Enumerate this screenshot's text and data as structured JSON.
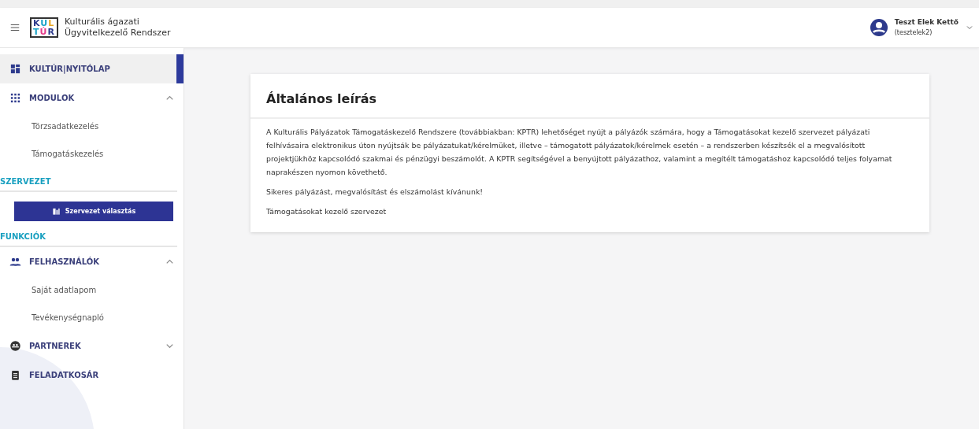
{
  "header": {
    "logo_top": "KUL",
    "logo_bottom": "TÚR",
    "app_title_line1": "Kulturális ágazati",
    "app_title_line2": "Ügyvitelkezelő Rendszer",
    "user_name": "Teszt Elek Kettő",
    "user_login": "(tesztelek2)"
  },
  "sidebar": [
    {
      "kind": "item",
      "label": "KULTÚR|NYITÓLAP",
      "selected": true
    },
    {
      "kind": "group",
      "label": "MODULOK",
      "expanded": true,
      "children": [
        {
          "label": "Törzsadatkezelés",
          "selected": false
        },
        {
          "label": "Támogatáskezelés",
          "selected": false
        }
      ]
    },
    {
      "kind": "heading",
      "label": "SZERVEZET"
    },
    {
      "kind": "button",
      "label": "Szervezet választás"
    },
    {
      "kind": "heading",
      "label": "FUNKCIÓK"
    },
    {
      "kind": "group",
      "label": "FELHASZNÁLÓK",
      "expanded": true,
      "children": [
        {
          "label": "Saját adatlapom",
          "selected": false
        },
        {
          "label": "Tevékenységnapló",
          "selected": false
        }
      ]
    },
    {
      "kind": "group",
      "label": "PARTNEREK",
      "expanded": false
    },
    {
      "kind": "item",
      "label": "FELADATKOSÁR",
      "selected": false
    }
  ],
  "card": {
    "title": "Általános leírás",
    "paragraphs": [
      "A Kulturális Pályázatok Támogatáskezelő Rendszere (továbbiakban: KPTR) lehetőséget nyújt a pályázók számára, hogy a Támogatásokat kezelő szervezet pályázati felhívásaira elektronikus úton nyújtsák be pályázatukat/kérelmüket, illetve – támogatott pályázatok/kérelmek esetén – a rendszerben készítsék el a megvalósított projektjükhöz kapcsolódó szakmai és pénzügyi beszámolót. A KPTR segítségével a benyújtott pályázathoz, valamint a megítélt támogatáshoz kapcsolódó teljes folyamat naprakészen nyomon követhető.",
      "Sikeres pályázást, megvalósítást és elszámolást kívánunk!",
      "Támogatásokat kezelő szervezet"
    ]
  }
}
